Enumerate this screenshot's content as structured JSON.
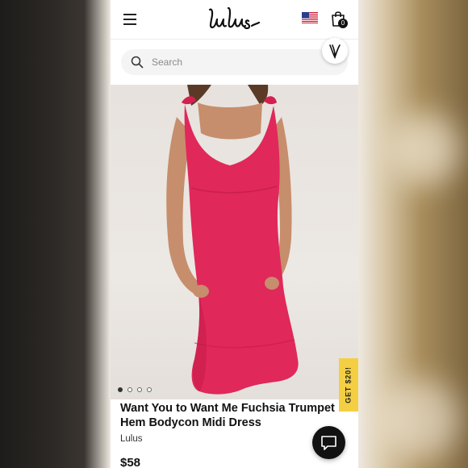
{
  "header": {
    "logo_text": "Lulus",
    "bag_count": "0",
    "region_flag": "us-flag-icon"
  },
  "search": {
    "placeholder": "Search"
  },
  "promo": {
    "label": "GET $20!"
  },
  "gallery": {
    "image_count": 4,
    "active_index": 0
  },
  "product": {
    "title_line1": "Want You to Want Me Fuchsia Trumpet",
    "title_line2": "Hem Bodycon Midi Dress",
    "brand": "Lulus",
    "price": "$58",
    "dress_color": "#e0285a"
  },
  "icons": {
    "menu": "hamburger-menu-icon",
    "bag": "shopping-bag-icon",
    "search": "search-icon",
    "vbadge": "v-logo-icon",
    "chat": "chat-bubble-icon"
  }
}
